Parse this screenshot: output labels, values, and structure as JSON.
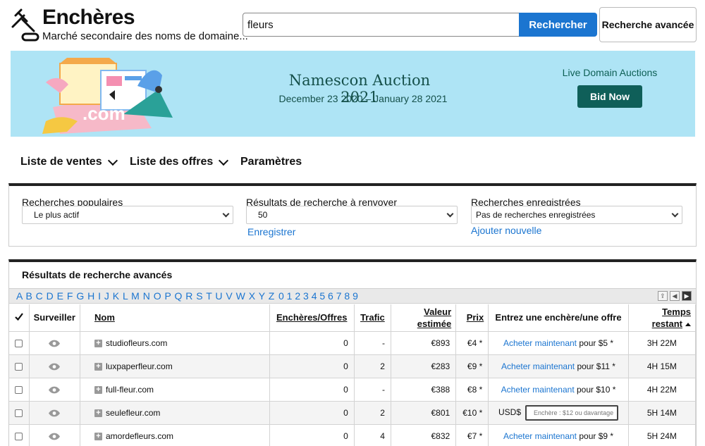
{
  "header": {
    "title": "Enchères",
    "subtitle": "Marché secondaire des noms de domaine...",
    "search_value": "fleurs",
    "search_button": "Rechercher",
    "advanced_button": "Recherche avancée"
  },
  "banner": {
    "title": "Namescon Auction 2021",
    "dates": "December 23 2020 – January 28 2021",
    "live_label": "Live Domain Auctions",
    "bid_button": "Bid Now",
    "art_text": ".com"
  },
  "nav": {
    "items": [
      {
        "label": "Liste de ventes"
      },
      {
        "label": "Liste des offres"
      },
      {
        "label": "Paramètres"
      }
    ]
  },
  "filters": {
    "popular_label": "Recherches populaires",
    "popular_value": "Le plus actif",
    "results_label": "Résultats de recherche à renvoyer",
    "results_value": "50",
    "save_link": "Enregistrer",
    "saved_label": "Recherches enregistrées",
    "saved_value": "Pas de recherches enregistrées",
    "add_link": "Ajouter nouvelle"
  },
  "results": {
    "title": "Résultats de recherche avancés",
    "letters": "A B C D E F G H I J K L M N O P Q R S T U V W X Y Z",
    "digits": "0 1 2 3 4 5 6 7 8 9",
    "columns": {
      "watch": "Surveiller",
      "name": "Nom",
      "bids": "Enchères/Offres",
      "traffic": "Trafic",
      "value": "Valeur estimée",
      "price": "Prix",
      "bid": "Entrez une enchère/une offre",
      "time": "Temps restant"
    },
    "rows": [
      {
        "name": "studiofleurs.com",
        "bids": "0",
        "traffic": "-",
        "value": "€893",
        "price": "€4 *",
        "buy": "Acheter maintenant",
        "buy_suffix": "pour $5 *",
        "time": "3H 22M"
      },
      {
        "name": "luxpaperfleur.com",
        "bids": "0",
        "traffic": "2",
        "value": "€283",
        "price": "€9 *",
        "buy": "Acheter maintenant",
        "buy_suffix": "pour $11 *",
        "time": "4H 15M"
      },
      {
        "name": "full-fleur.com",
        "bids": "0",
        "traffic": "-",
        "value": "€388",
        "price": "€8 *",
        "buy": "Acheter maintenant",
        "buy_suffix": "pour $10 *",
        "time": "4H 22M"
      },
      {
        "name": "seulefleur.com",
        "bids": "0",
        "traffic": "2",
        "value": "€801",
        "price": "€10 *",
        "currency": "USD$",
        "bid_placeholder": "Enchère : $12 ou davantage",
        "time": "5H 14M"
      },
      {
        "name": "amordefleurs.com",
        "bids": "0",
        "traffic": "4",
        "value": "€832",
        "price": "€7 *",
        "buy": "Acheter maintenant",
        "buy_suffix": "pour $9 *",
        "time": "5H 24M"
      }
    ]
  }
}
